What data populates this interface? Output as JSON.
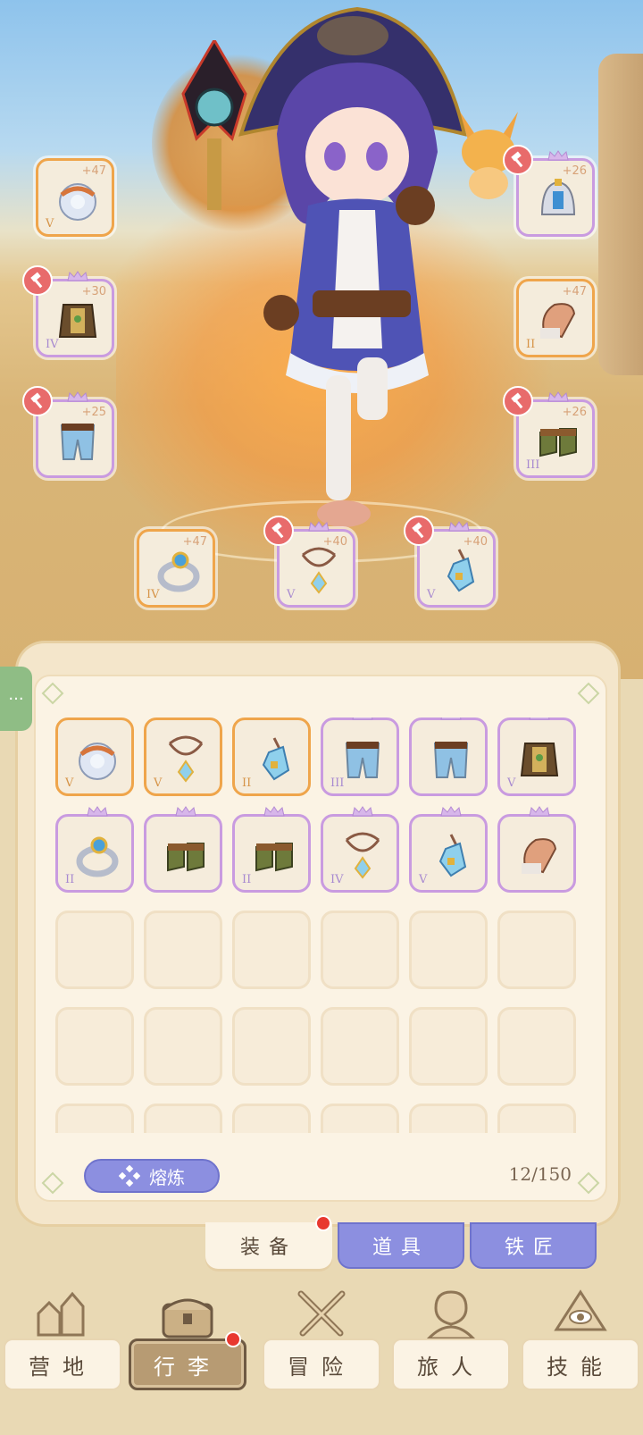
{
  "equipped_slots": [
    {
      "id": "orb",
      "tier": "V",
      "level": "+47",
      "rarity": "gold",
      "hammer": false,
      "crown": false,
      "icon": "orb-icon"
    },
    {
      "id": "helmet",
      "tier": "",
      "level": "+26",
      "rarity": "purple",
      "hammer": true,
      "crown": true,
      "icon": "helmet-icon"
    },
    {
      "id": "armor",
      "tier": "IV",
      "level": "+30",
      "rarity": "purple",
      "hammer": true,
      "crown": true,
      "icon": "armor-icon"
    },
    {
      "id": "gloves",
      "tier": "II",
      "level": "+47",
      "rarity": "gold",
      "hammer": false,
      "crown": false,
      "icon": "gloves-icon"
    },
    {
      "id": "pants",
      "tier": "",
      "level": "+25",
      "rarity": "purple",
      "hammer": true,
      "crown": true,
      "icon": "pants-icon"
    },
    {
      "id": "boots",
      "tier": "III",
      "level": "+26",
      "rarity": "purple",
      "hammer": true,
      "crown": true,
      "icon": "boots-icon"
    },
    {
      "id": "ring",
      "tier": "IV",
      "level": "+47",
      "rarity": "gold",
      "hammer": false,
      "crown": false,
      "icon": "ring-icon"
    },
    {
      "id": "necklace",
      "tier": "V",
      "level": "+40",
      "rarity": "purple",
      "hammer": true,
      "crown": true,
      "icon": "necklace-icon"
    },
    {
      "id": "pendant",
      "tier": "V",
      "level": "+40",
      "rarity": "purple",
      "hammer": true,
      "crown": true,
      "icon": "pendant-icon"
    }
  ],
  "inventory": {
    "items": [
      {
        "tier": "V",
        "rarity": "gold",
        "icon": "orb-icon"
      },
      {
        "tier": "V",
        "rarity": "gold",
        "icon": "necklace-icon"
      },
      {
        "tier": "II",
        "rarity": "gold",
        "icon": "pendant-icon"
      },
      {
        "tier": "III",
        "rarity": "purple",
        "icon": "pants-icon"
      },
      {
        "tier": "",
        "rarity": "purple",
        "icon": "pants-icon"
      },
      {
        "tier": "V",
        "rarity": "purple",
        "icon": "armor-icon"
      },
      {
        "tier": "II",
        "rarity": "purple",
        "icon": "ring-icon"
      },
      {
        "tier": "",
        "rarity": "purple",
        "icon": "boots-icon"
      },
      {
        "tier": "II",
        "rarity": "purple",
        "icon": "boots-icon"
      },
      {
        "tier": "IV",
        "rarity": "purple",
        "icon": "necklace-icon"
      },
      {
        "tier": "V",
        "rarity": "purple",
        "icon": "pendant-icon"
      },
      {
        "tier": "",
        "rarity": "purple",
        "icon": "gloves-icon"
      }
    ],
    "empty_cells": 18,
    "smelt_label": "熔炼",
    "capacity": "12/150",
    "side_tab_label": "···"
  },
  "sub_tabs": [
    {
      "label": "装备",
      "active": true,
      "red_dot": true
    },
    {
      "label": "道具",
      "active": false,
      "red_dot": false
    },
    {
      "label": "铁匠",
      "active": false,
      "red_dot": false
    }
  ],
  "bottom_nav": [
    {
      "label": "营地",
      "icon": "camp-icon",
      "active": false,
      "red_dot": false
    },
    {
      "label": "行李",
      "icon": "chest-icon",
      "active": true,
      "red_dot": true
    },
    {
      "label": "冒险",
      "icon": "swords-icon",
      "active": false,
      "red_dot": false
    },
    {
      "label": "旅人",
      "icon": "traveler-icon",
      "active": false,
      "red_dot": false
    },
    {
      "label": "技能",
      "icon": "skill-eye-icon",
      "active": false,
      "red_dot": false
    }
  ],
  "colors": {
    "gold_rarity": "#efa54b",
    "purple_rarity": "#c99be0",
    "tab_purple": "#8c8fe0",
    "red_badge": "#e8382f",
    "panel_bg": "#fbf3e4"
  }
}
